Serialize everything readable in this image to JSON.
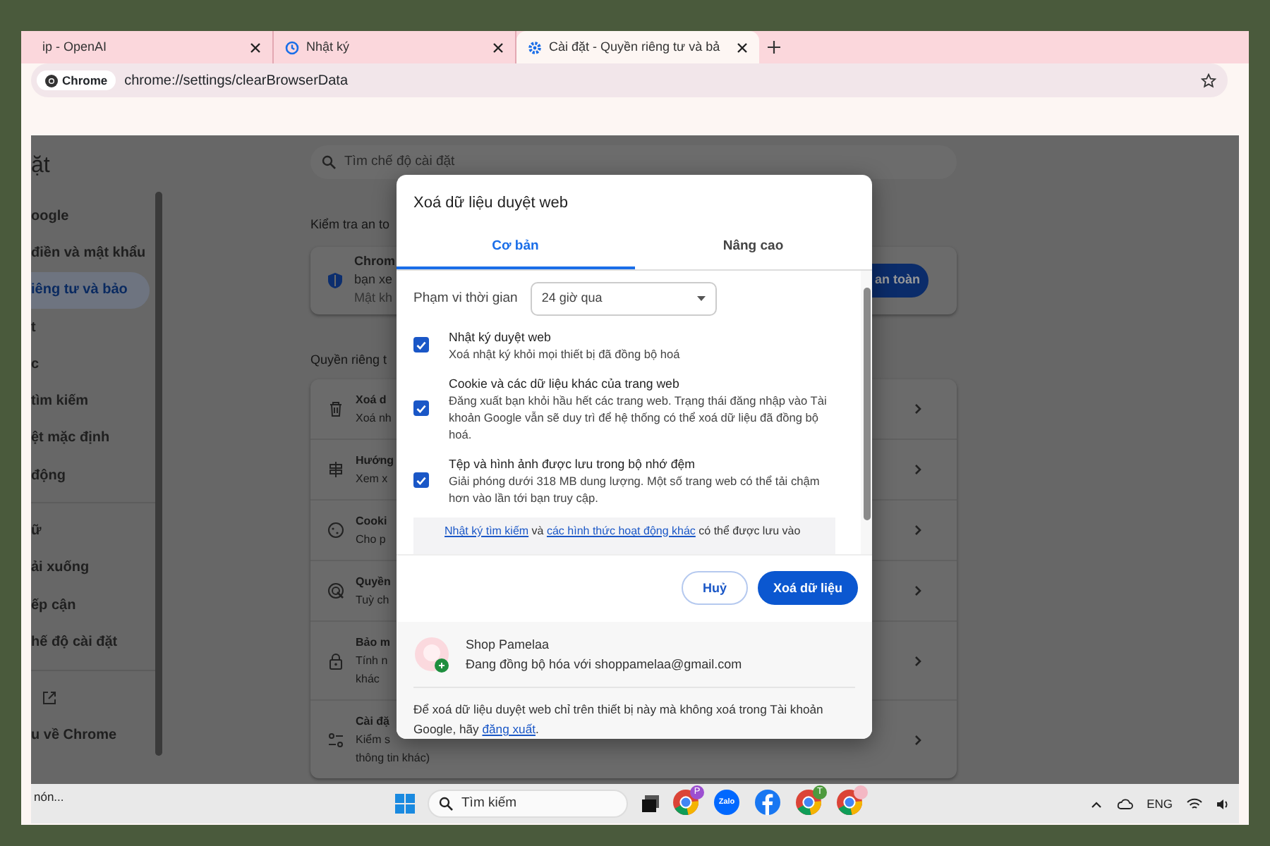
{
  "browser": {
    "tabs": [
      {
        "title": "ip - OpenAI",
        "selected": false,
        "kind": "plain"
      },
      {
        "title": "Nhật ký",
        "selected": false,
        "kind": "history"
      },
      {
        "title": "Cài đặt - Quyền riêng tư và bả",
        "selected": true,
        "kind": "settings"
      }
    ],
    "address": {
      "chip": "Chrome",
      "url": "chrome://settings/clearBrowserData"
    }
  },
  "sidebar": {
    "heading": "ặt",
    "items": [
      {
        "label": "oogle",
        "selected": false
      },
      {
        "label": "điền và mật khẩu",
        "selected": false
      },
      {
        "label": "iêng tư và bảo",
        "selected": true
      },
      {
        "label": "t",
        "selected": false
      },
      {
        "label": "c",
        "selected": false
      },
      {
        "label": "tìm kiếm",
        "selected": false
      },
      {
        "label": "ệt mặc định",
        "selected": false
      },
      {
        "label": "động",
        "selected": false,
        "divider_after": true
      },
      {
        "label": "ữ",
        "selected": false
      },
      {
        "label": "ải xuống",
        "selected": false
      },
      {
        "label": "ếp cận",
        "selected": false
      },
      {
        "label": "hế độ cài đặt",
        "selected": false,
        "divider_after": true
      },
      {
        "kind": "external",
        "selected": false
      },
      {
        "label": "u về Chrome",
        "selected": false
      }
    ]
  },
  "settings": {
    "search_placeholder": "Tìm chế độ cài đặt",
    "safety_heading": "Kiểm tra an to",
    "safety_card": {
      "lines": [
        "Chrom",
        "bạn xe",
        "Mật kh"
      ],
      "button": "an toàn"
    },
    "privacy_heading": "Quyền riêng t",
    "rows": [
      {
        "kind": "trash",
        "lines": [
          "Xoá d",
          "Xoá nh"
        ]
      },
      {
        "kind": "guide",
        "lines": [
          "Hướng",
          "Xem x"
        ]
      },
      {
        "kind": "cookie",
        "lines": [
          "Cooki",
          "Cho p"
        ]
      },
      {
        "kind": "target",
        "lines": [
          "Quyền",
          "Tuỳ ch"
        ]
      },
      {
        "kind": "lock",
        "lines": [
          "Bảo m",
          "Tính n",
          "khác"
        ]
      },
      {
        "kind": "sliders",
        "lines": [
          "Cài đặ",
          "Kiểm s",
          "thông tin khác)"
        ]
      }
    ]
  },
  "dialog": {
    "title": "Xoá dữ liệu duyệt web",
    "tabs": [
      {
        "label": "Cơ bản",
        "selected": true
      },
      {
        "label": "Nâng cao",
        "selected": false
      }
    ],
    "range_label": "Phạm vi thời gian",
    "range_value": "24 giờ qua",
    "options": [
      {
        "title": "Nhật ký duyệt web",
        "description": "Xoá nhật ký khỏi mọi thiết bị đã đồng bộ hoá",
        "checked": true
      },
      {
        "title": "Cookie và các dữ liệu khác của trang web",
        "description": "Đăng xuất bạn khỏi hầu hết các trang web. Trạng thái đăng nhập vào Tài khoản Google vẫn sẽ duy trì để hệ thống có thể xoá dữ liệu đã đồng bộ hoá.",
        "checked": true
      },
      {
        "title": "Tệp và hình ảnh được lưu trong bộ nhớ đệm",
        "description": "Giải phóng dưới 318 MB dung lượng. Một số trang web có thể tải chậm hơn vào lần tới bạn truy cập.",
        "checked": true
      }
    ],
    "info": [
      {
        "text": "Nhật ký tìm kiếm",
        "link": true
      },
      {
        "text": " và ",
        "link": false
      },
      {
        "text": "các hình thức hoạt động khác",
        "link": true
      },
      {
        "text": " có thể được lưu vào",
        "link": false
      }
    ],
    "cancel": "Huỷ",
    "confirm": "Xoá dữ liệu",
    "account": {
      "name": "Shop Pamelaa",
      "status": "Đang đồng bộ hóa với shoppamelaa@gmail.com"
    },
    "footer": [
      {
        "text": "Để xoá dữ liệu duyệt web chỉ trên thiết bị này mà không xoá trong Tài khoản Google, hãy ",
        "link": false
      },
      {
        "text": "đăng xuất",
        "link": true
      },
      {
        "text": ".",
        "link": false
      }
    ]
  },
  "taskbar": {
    "tooltip": "nón...",
    "search": "Tìm kiếm",
    "apps": [
      {
        "kind": "chrome",
        "badge": "P",
        "color": "#9c4fd1"
      },
      {
        "kind": "zalo",
        "label": "Zalo"
      },
      {
        "kind": "facebook"
      },
      {
        "kind": "chrome",
        "badge": "T",
        "color": "#4e9a3e"
      },
      {
        "kind": "chrome",
        "color": "#f4b8c4"
      }
    ],
    "language": "ENG"
  }
}
